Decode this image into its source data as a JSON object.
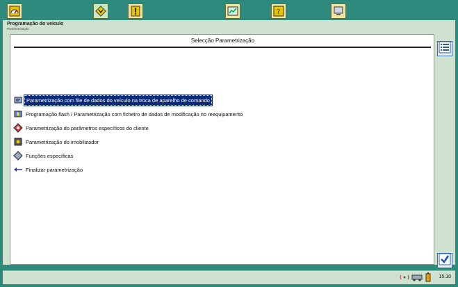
{
  "header": {
    "title": "Programação do veículo",
    "subtitle": "Parametrização"
  },
  "panel": {
    "title": "Selecção Parametrização"
  },
  "menu": {
    "items": [
      {
        "label": "Parametrização com file de dados do veículo na troca de aparelho de comando",
        "icon": "vehicle-data-icon",
        "selected": true
      },
      {
        "label": "Programação flash / Parametrização com ficheiro de dados de modificação no reequipamento",
        "icon": "flash-program-icon",
        "selected": false
      },
      {
        "label": "Parametrização do parâmetros específicos do cliente",
        "icon": "customer-params-icon",
        "selected": false
      },
      {
        "label": "Parametrização do imobilizador",
        "icon": "immobilizer-icon",
        "selected": false
      },
      {
        "label": "Funções específicas",
        "icon": "special-functions-icon",
        "selected": false
      },
      {
        "label": "Finalizar parametrização",
        "icon": "back-arrow-icon",
        "selected": false
      }
    ]
  },
  "status": {
    "time": "15:10"
  },
  "colors": {
    "frame": "#2e8a7c",
    "panel_bg": "#cfe2cf",
    "selection": "#0b2a78"
  }
}
